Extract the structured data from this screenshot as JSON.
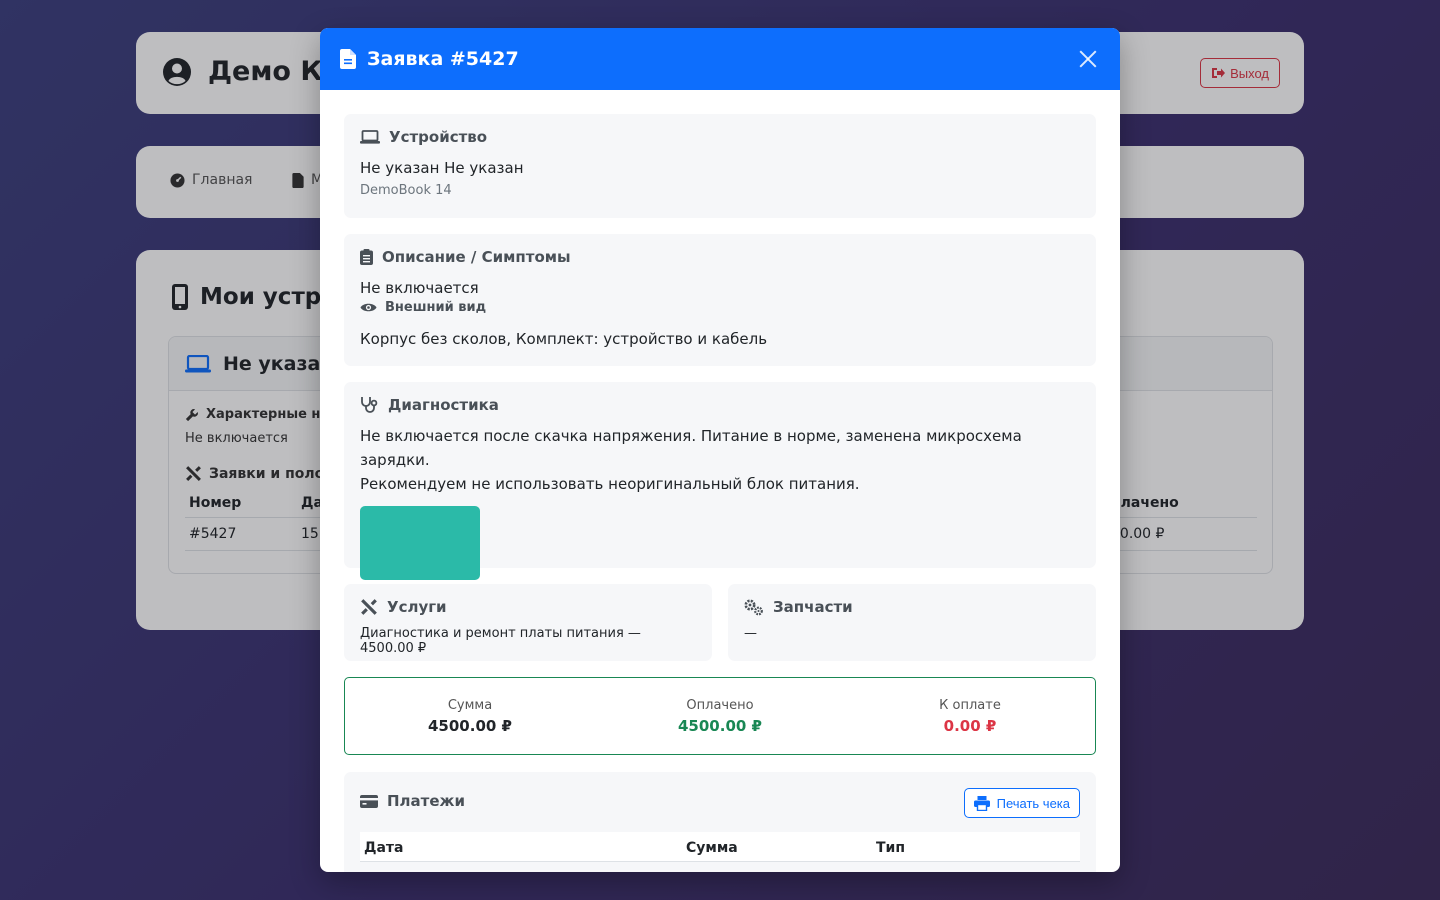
{
  "colors": {
    "primary": "#0d6efd",
    "success": "#198754",
    "danger": "#dc3545",
    "thumbnail": "#2bbaa8"
  },
  "background": {
    "header": {
      "title": "Демо Кл",
      "logout_label": "Выход"
    },
    "nav": {
      "home": "Главная",
      "second": "М"
    },
    "devices": {
      "section_title": "Мои устро",
      "card_title": "Не указан",
      "faults_label": "Характерные неи",
      "faults_value": "Не включается",
      "orders_label": "Заявки и поло",
      "table_headers": [
        "Номер",
        "Да",
        "плачено"
      ],
      "row": {
        "number": "#5427",
        "date": "15.",
        "paid": "00.00 ₽"
      }
    }
  },
  "modal": {
    "title": "Заявка #5427",
    "device": {
      "label": "Устройство",
      "name": "Не указан Не указан",
      "model": "DemoBook 14"
    },
    "description": {
      "label": "Описание / Симптомы",
      "text": "Не включается",
      "appearance_label": "Внешний вид",
      "appearance_text": "Корпус без сколов, Комплект: устройство и кабель"
    },
    "diagnostics": {
      "label": "Диагностика",
      "line1": "Не включается после скачка напряжения. Питание в норме, заменена микросхема зарядки.",
      "line2": "Рекомендуем не использовать неоригинальный блок питания."
    },
    "services": {
      "label": "Услуги",
      "text": "Диагностика и ремонт платы питания — 4500.00 ₽"
    },
    "parts": {
      "label": "Запчасти",
      "text": "—"
    },
    "summary": {
      "total_label": "Сумма",
      "total_value": "4500.00 ₽",
      "paid_label": "Оплачено",
      "paid_value": "4500.00 ₽",
      "due_label": "К оплате",
      "due_value": "0.00 ₽"
    },
    "payments": {
      "label": "Платежи",
      "print_label": "Печать чека",
      "headers": [
        "Дата",
        "Сумма",
        "Тип"
      ]
    }
  }
}
